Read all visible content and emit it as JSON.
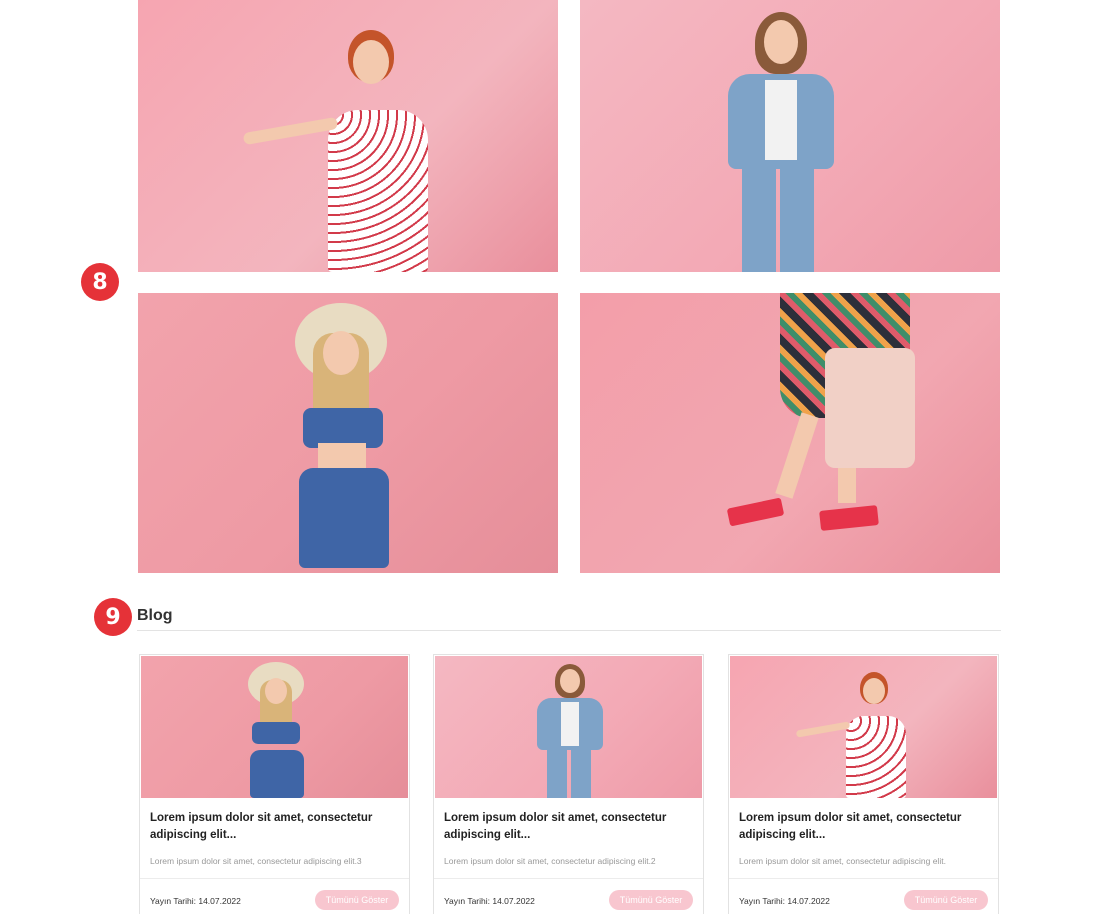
{
  "markers": {
    "gallery": "8",
    "blog": "9"
  },
  "gallery": {
    "photos": [
      {
        "alt": "Woman in floral dress with confetti"
      },
      {
        "alt": "Woman in denim jacket and jeans"
      },
      {
        "alt": "Woman with sun hat and denim outfit"
      },
      {
        "alt": "Woman in floral skirt with backpack and heels"
      }
    ]
  },
  "blog": {
    "title": "Blog",
    "cards": [
      {
        "heading": "Lorem ipsum dolor sit amet, consectetur adipiscing elit...",
        "excerpt": "Lorem ipsum dolor sit amet, consectetur adipiscing elit.3",
        "date": "Yayın Tarihi: 14.07.2022",
        "button": "Tümünü Göster"
      },
      {
        "heading": "Lorem ipsum dolor sit amet, consectetur adipiscing elit...",
        "excerpt": "Lorem ipsum dolor sit amet, consectetur adipiscing elit.2",
        "date": "Yayın Tarihi: 14.07.2022",
        "button": "Tümünü Göster"
      },
      {
        "heading": "Lorem ipsum dolor sit amet, consectetur adipiscing elit...",
        "excerpt": "Lorem ipsum dolor sit amet, consectetur adipiscing elit.",
        "date": "Yayın Tarihi: 14.07.2022",
        "button": "Tümünü Göster"
      }
    ]
  },
  "colors": {
    "badge": "#e53238",
    "button": "#f8c6cf",
    "background": "#ffffff"
  }
}
